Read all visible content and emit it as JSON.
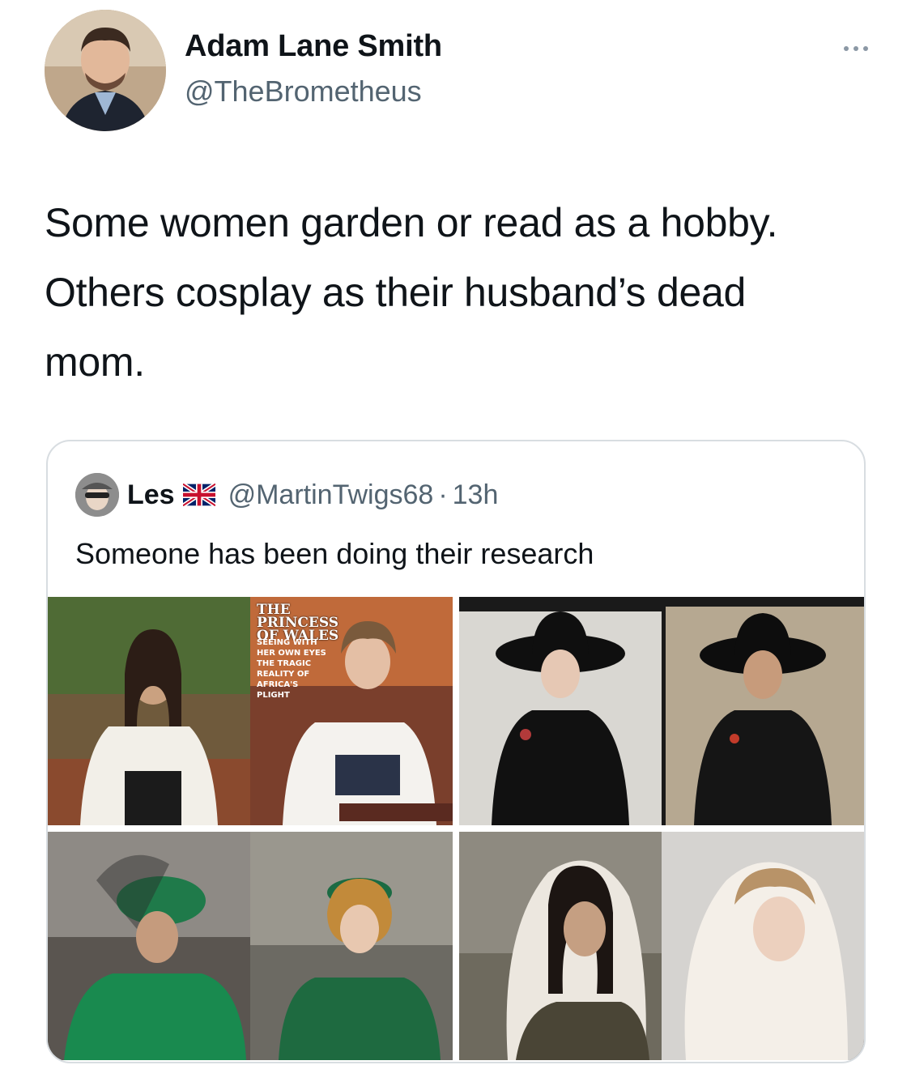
{
  "tweet": {
    "author": {
      "display_name": "Adam Lane Smith",
      "handle": "@TheBrometheus",
      "avatar_icon": "profile-photo"
    },
    "more_icon": "ellipsis-icon",
    "text": "Some women garden or read as a hobby. Others cosplay as their husband’s dead mom."
  },
  "quote_tweet": {
    "author": {
      "display_name": "Les",
      "flag_icon": "uk-flag-icon",
      "handle": "@MartinTwigs68",
      "separator": "·",
      "time": "13h"
    },
    "text": "Someone has been doing their research",
    "photos": [
      {
        "name": "white-blouse-comparison",
        "magazine_headline": "THE PRINCESS OF WALES",
        "magazine_sub": "SEEING WITH HER OWN EYES THE TRAGIC REALITY OF AFRICA'S PLIGHT"
      },
      {
        "name": "black-wide-hat-comparison"
      },
      {
        "name": "green-fascinator-comparison"
      },
      {
        "name": "white-headscarf-comparison"
      }
    ]
  },
  "colors": {
    "text_primary": "#0f1419",
    "text_secondary": "#536471",
    "border": "#d8dde1",
    "background": "#ffffff"
  }
}
